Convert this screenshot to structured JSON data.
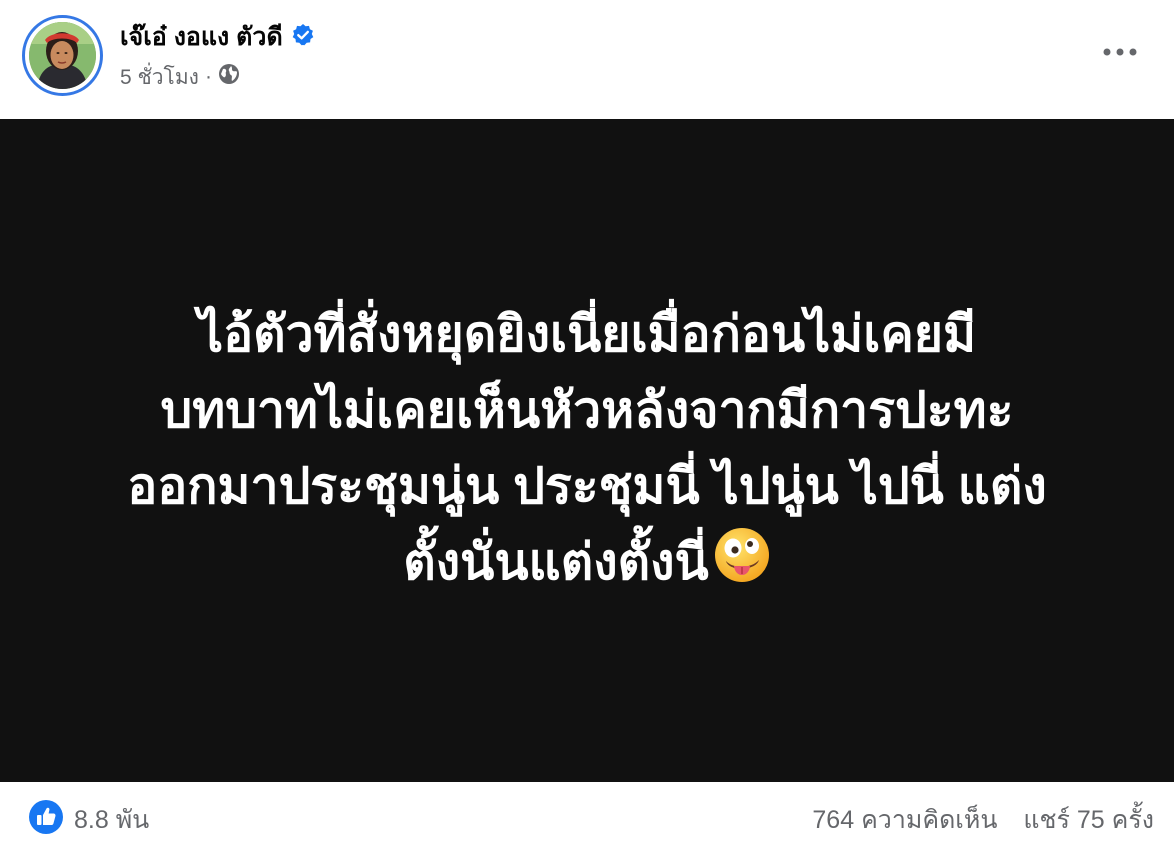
{
  "post": {
    "author": {
      "name": "เจ๊เอ๋ งอแง ตัวดี",
      "verified_icon": "verified-badge-icon",
      "avatar_icon": "profile-photo"
    },
    "time": "5 ชั่วโมง",
    "separator": "·",
    "privacy_icon": "globe-icon",
    "more_icon": "more-options-icon",
    "text_lines": [
      "ไอ้ตัวที่สั่งหยุดยิงเนี่ยเมื่อก่อนไม่เคยมี",
      "บทบาทไม่เคยเห็นหัวหลังจากมีการปะทะ",
      "ออกมาประชุมนู่น ประชุมนี่ ไปนู่น ไปนี่ แต่ง",
      "ตั้งนั่นแต่งตั้งนี่"
    ],
    "emoji_icon": "zany-face-emoji",
    "background_color": "#111111",
    "text_color": "#ffffff"
  },
  "engagement": {
    "reaction_icon": "like-icon",
    "reaction_count": "8.8 พัน",
    "comments": "764 ความคิดเห็น",
    "shares": "แชร์ 75 ครั้ง"
  },
  "colors": {
    "accent": "#1877f2",
    "secondary_text": "#65676b"
  }
}
